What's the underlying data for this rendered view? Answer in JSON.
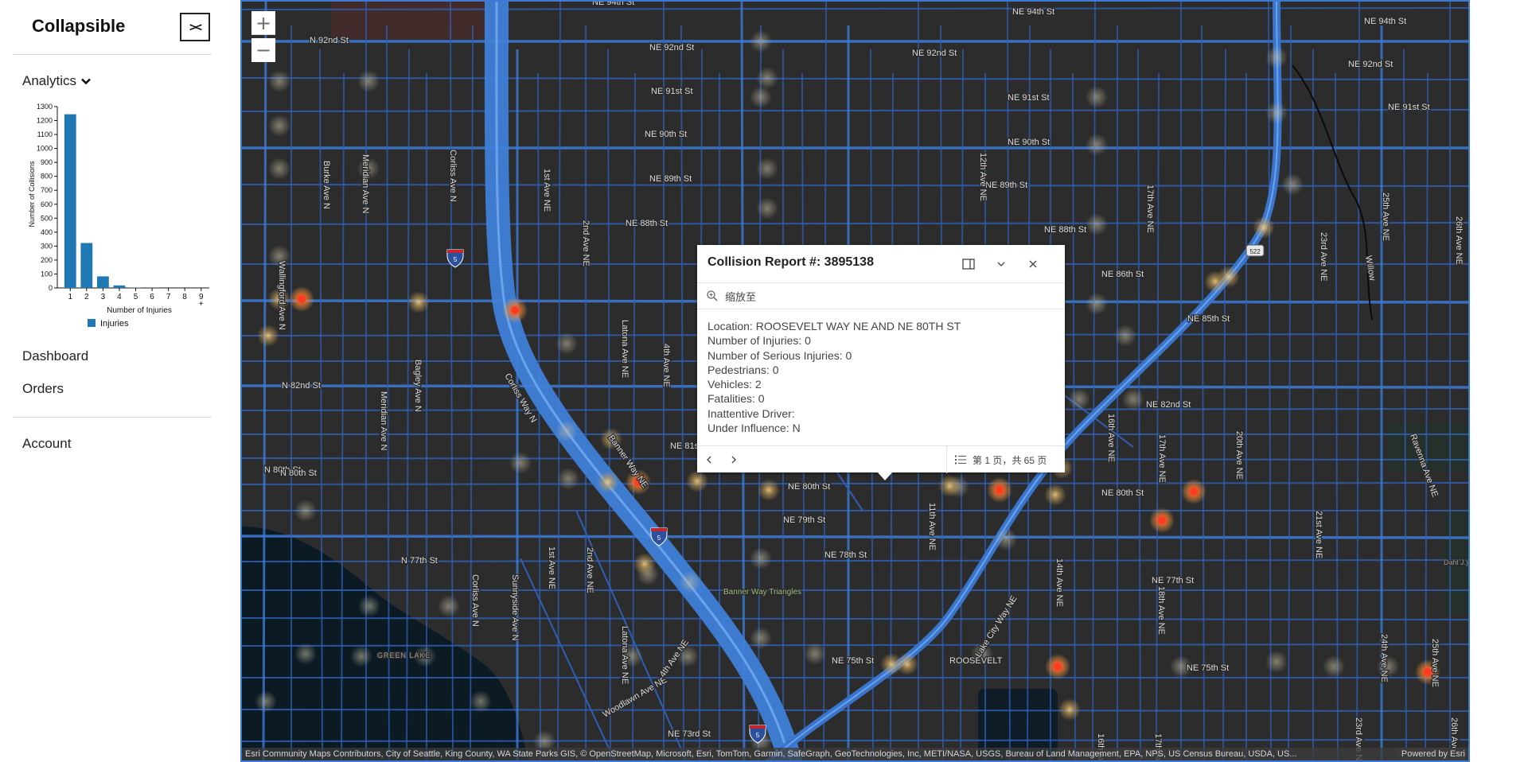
{
  "sidebar": {
    "title": "Collapsible",
    "collapse_label": "><",
    "analytics_label": "Analytics",
    "items": [
      {
        "label": "Dashboard"
      },
      {
        "label": "Orders"
      },
      {
        "label": "Account"
      }
    ]
  },
  "chart_data": {
    "type": "bar",
    "categories": [
      "1",
      "2",
      "3",
      "4",
      "5",
      "6",
      "7",
      "8",
      "9\n+"
    ],
    "series": [
      {
        "name": "Injuries",
        "values": [
          1245,
          322,
          83,
          18,
          2,
          1,
          0,
          0,
          0
        ]
      }
    ],
    "xlabel": "Number of Injuries",
    "ylabel": "Number of Collisions",
    "ylim": [
      0,
      1300
    ],
    "yticks": [
      0,
      100,
      200,
      300,
      400,
      500,
      600,
      700,
      800,
      900,
      1000,
      1100,
      1200,
      1300
    ],
    "legend_position": "bottom",
    "color": "#1f77b4"
  },
  "map": {
    "zoom_in": "+",
    "zoom_out": "−",
    "attribution": "Esri Community Maps Contributors, City of Seattle, King County, WA State Parks GIS, © OpenStreetMap, Microsoft, Esri, TomTom, Garmin, SafeGraph, GeoTechnologies, Inc, METI/NASA, USGS, Bureau of Land Management, EPA, NPS, US Census Bureau, USDA, US...",
    "powered": "Powered by Esri",
    "shields": {
      "i5": "5",
      "sr522": "522"
    },
    "street_labels": [
      "NE 94th St",
      "NE 94th St",
      "NE 94th St",
      "N 92nd St",
      "NE 92nd St",
      "NE 92nd St",
      "NE 92nd St",
      "NE 91st St",
      "NE 91st St",
      "NE 91st St",
      "NE 90th St",
      "NE 90th St",
      "NE 89th St",
      "NE 89th St",
      "NE 88th St",
      "NE 88th St",
      "NE 86th St",
      "NE 85th St",
      "NE 82nd St",
      "NE 82nd St",
      "NE 81st St",
      "N 82nd St",
      "N 80th St",
      "N 80th St",
      "NE 80th St",
      "NE 80th St",
      "NE 79th St",
      "NE 78th St",
      "N 77th St",
      "NE 77th St",
      "NE 75th St",
      "NE 75th St",
      "NE 73rd St",
      "ROOSEVELT",
      "Burke Ave N",
      "Meridian Ave N",
      "Corliss Ave N",
      "Wallingford Ave N",
      "Bagley Ave N",
      "Meridian Ave N",
      "1st Ave NE",
      "2nd Ave NE",
      "Latona Ave NE",
      "4th Ave NE",
      "12th Ave NE",
      "17th Ave NE",
      "23rd Ave NE",
      "25th Ave NE",
      "26th Ave NE",
      "16th Ave NE",
      "17th Ave NE",
      "20th Ave NE",
      "21st Ave NE",
      "14th Ave NE",
      "11th Ave NE",
      "18th Ave NE",
      "24th Ave NE",
      "25th Ave NE",
      "Ravenna Ave NE",
      "Banner Way NE",
      "Corliss Way N",
      "Lake City Way NE",
      "Sunnyside Ave N",
      "1st Ave NE",
      "2nd Ave NE",
      "Latona Ave NE",
      "Corliss Ave N",
      "Woodlawn Ave NE",
      "4th Ave NE",
      "16th Ave NE",
      "17th Ave NE",
      "23rd Ave NE",
      "26th Ave NE",
      "Willow"
    ],
    "places": {
      "banner_way_triangle": "Banner Way Triangles",
      "green_lake": "GREEN LAKE",
      "dahl": "Dahl J.) Pl"
    }
  },
  "popup": {
    "title": "Collision Report #: 3895138",
    "zoom_to": "缩放至",
    "lines": [
      "Location: ROOSEVELT WAY NE AND NE 80TH ST",
      "Number of Injuries: 0",
      "Number of Serious Injuries: 0",
      "Pedestrians: 0",
      "Vehicles: 2",
      "Fatalities: 0",
      "Inattentive Driver:",
      "Under Influence: N"
    ],
    "pager": "第 1 页，共 65 页"
  }
}
